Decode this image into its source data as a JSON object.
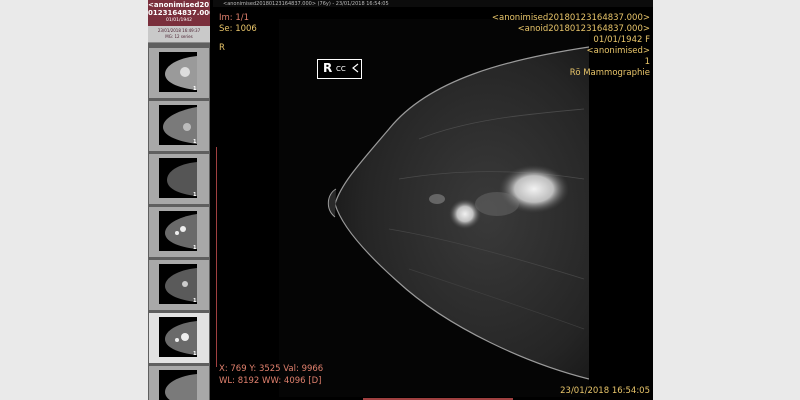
{
  "topbar": {
    "text": "<anonimised20180123164837.000>   (76y) - 23/01/2018 16:54:05"
  },
  "sidebar": {
    "patient_name_1": "<anonimised2018",
    "patient_name_2": "0123164837.000>",
    "patient_dob": "01/01/1942",
    "study_datetime": "23/01/2018 16:49:37",
    "study_desc": "MG: 12 series",
    "thumbs": [
      {
        "count": "1"
      },
      {
        "count": "1"
      },
      {
        "count": "1"
      },
      {
        "count": "1"
      },
      {
        "count": "1"
      },
      {
        "count": "1"
      },
      {
        "count": "1"
      }
    ]
  },
  "overlay": {
    "image_index": "Im: 1/1",
    "series": "Se: 1006",
    "side_marker": "R",
    "view_side": "R",
    "view_code": "CC",
    "patient_name": "<anonimised20180123164837.000>",
    "patient_id": "<anoid20180123164837.000>",
    "dob_sex": "01/01/1942 F",
    "physician": "<anonimised>",
    "series_number": "1",
    "modality": "Rö Mammographie",
    "cursor": "X: 769 Y: 3525 Val: 9966",
    "window": "WL: 8192 WW: 4096 [D]",
    "datetime": "23/01/2018 16:54:05"
  }
}
